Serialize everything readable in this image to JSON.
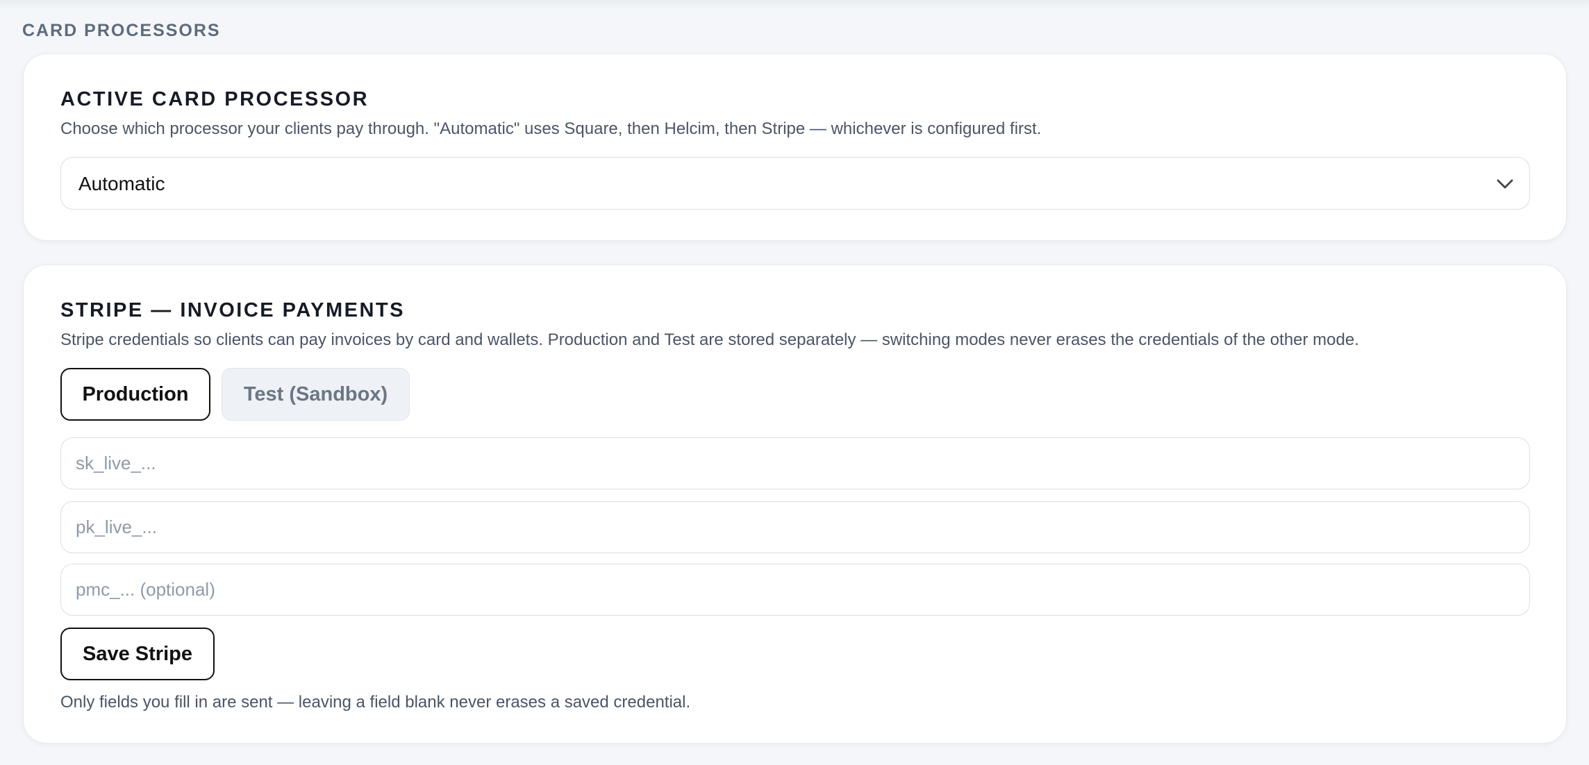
{
  "section_label": "CARD PROCESSORS",
  "active_processor": {
    "title": "ACTIVE CARD PROCESSOR",
    "description": "Choose which processor your clients pay through. \"Automatic\" uses Square, then Helcim, then Stripe — whichever is configured first.",
    "select_value": "Automatic",
    "select_icon": "chevron-down-icon"
  },
  "stripe": {
    "title": "STRIPE — INVOICE PAYMENTS",
    "description": "Stripe credentials so clients can pay invoices by card and wallets. Production and Test are stored separately — switching modes never erases the credentials of the other mode.",
    "tabs": [
      {
        "label": "Production",
        "active": true
      },
      {
        "label": "Test (Sandbox)",
        "active": false
      }
    ],
    "fields": {
      "secret_key_placeholder": "sk_live_...",
      "publishable_key_placeholder": "pk_live_...",
      "pmc_placeholder": "pmc_... (optional)"
    },
    "save_label": "Save Stripe",
    "footnote": "Only fields you fill in are sent — leaving a field blank never erases a saved credential."
  }
}
